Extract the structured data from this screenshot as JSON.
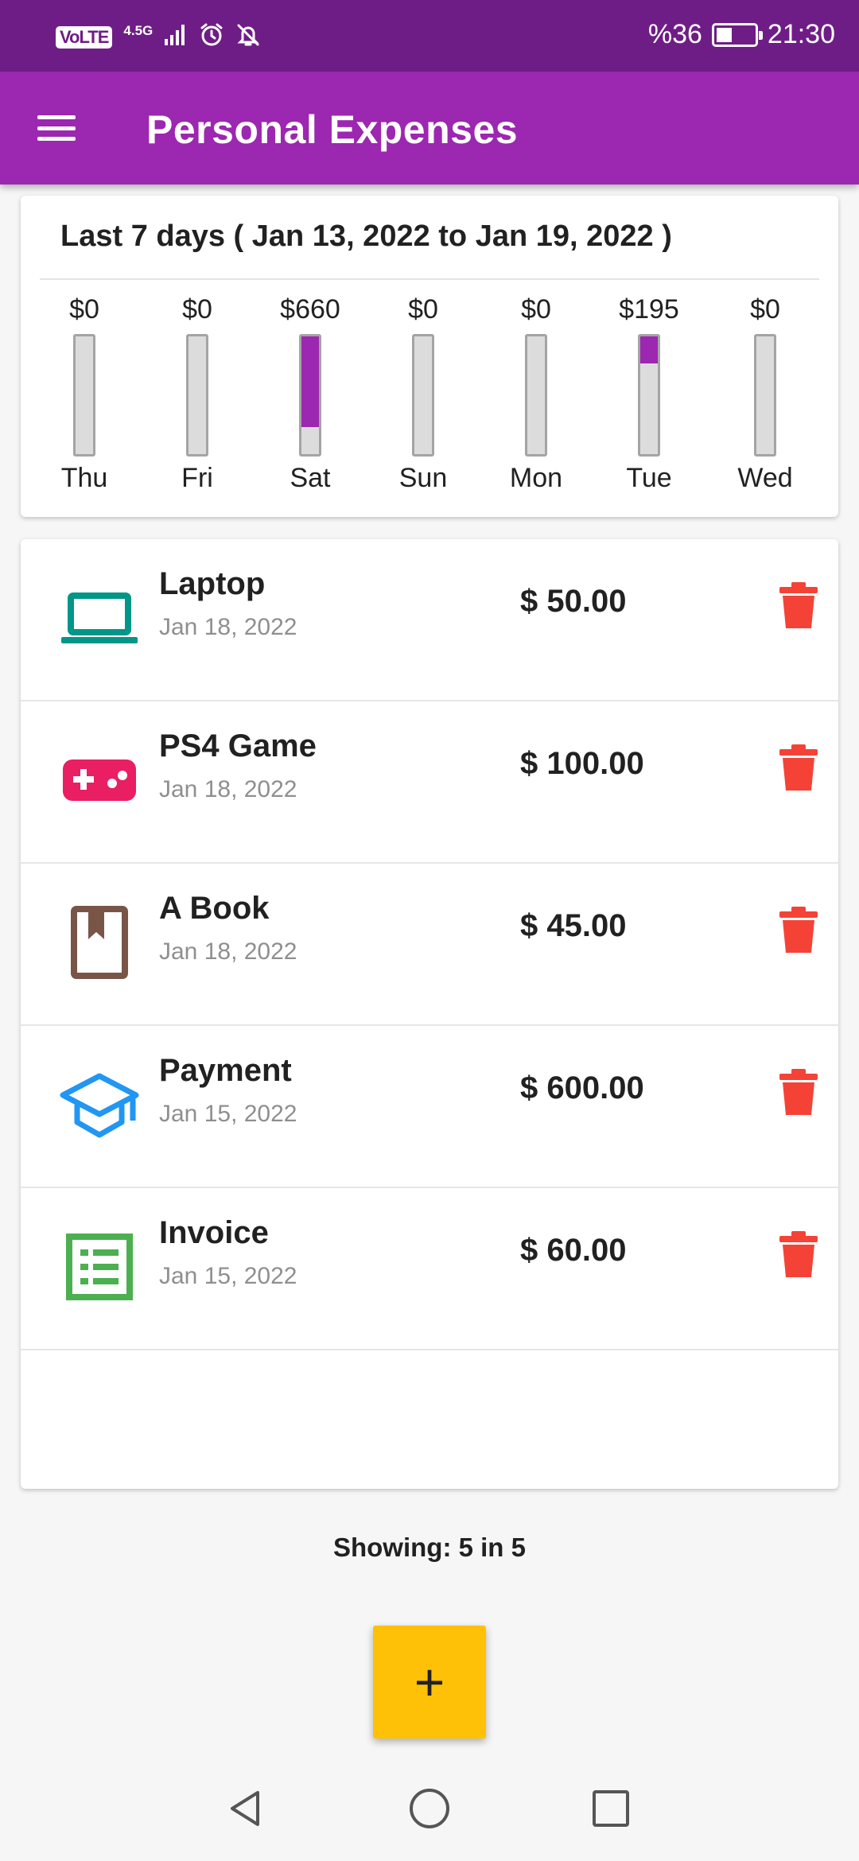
{
  "status_bar": {
    "volte": "VoLTE",
    "network": "4.5G",
    "battery": "%36",
    "battery_level": 0.36,
    "time": "21:30",
    "icons": [
      "signal-icon",
      "alarm-icon",
      "notifications-off-icon",
      "battery-charging-icon"
    ]
  },
  "app_bar": {
    "title": "Personal Expenses",
    "menu_icon": "menu-icon"
  },
  "chart": {
    "title": "Last 7 days ( Jan 13, 2022 to Jan 19, 2022 )",
    "bars": [
      {
        "day": "Thu",
        "amount": "$0",
        "fraction": 0
      },
      {
        "day": "Fri",
        "amount": "$0",
        "fraction": 0
      },
      {
        "day": "Sat",
        "amount": "$660",
        "fraction": 0.77
      },
      {
        "day": "Sun",
        "amount": "$0",
        "fraction": 0
      },
      {
        "day": "Mon",
        "amount": "$0",
        "fraction": 0
      },
      {
        "day": "Tue",
        "amount": "$195",
        "fraction": 0.23
      },
      {
        "day": "Wed",
        "amount": "$0",
        "fraction": 0
      }
    ],
    "bar_color": "#9c27b0"
  },
  "transactions": [
    {
      "title": "Laptop",
      "date": "Jan 18, 2022",
      "amount": "$ 50.00",
      "icon": "laptop-icon",
      "icon_color": "#009688"
    },
    {
      "title": "PS4 Game",
      "date": "Jan 18, 2022",
      "amount": "$ 100.00",
      "icon": "gamepad-icon",
      "icon_color": "#e91e63"
    },
    {
      "title": "A Book",
      "date": "Jan 18, 2022",
      "amount": "$ 45.00",
      "icon": "book-icon",
      "icon_color": "#795548"
    },
    {
      "title": "Payment",
      "date": "Jan 15, 2022",
      "amount": "$ 600.00",
      "icon": "school-icon",
      "icon_color": "#2196f3"
    },
    {
      "title": "Invoice",
      "date": "Jan 15, 2022",
      "amount": "$ 60.00",
      "icon": "list-alt-icon",
      "icon_color": "#4caf50"
    }
  ],
  "delete_icon": "delete-icon",
  "delete_color": "#f44336",
  "footer": {
    "showing": "Showing: 5 in 5"
  },
  "fab": {
    "label": "+"
  },
  "nav": [
    "back-icon",
    "home-icon",
    "recents-icon"
  ],
  "colors": {
    "primary": "#9c27b0",
    "primary_dark": "#6f1d86",
    "accent": "#ffc107"
  }
}
